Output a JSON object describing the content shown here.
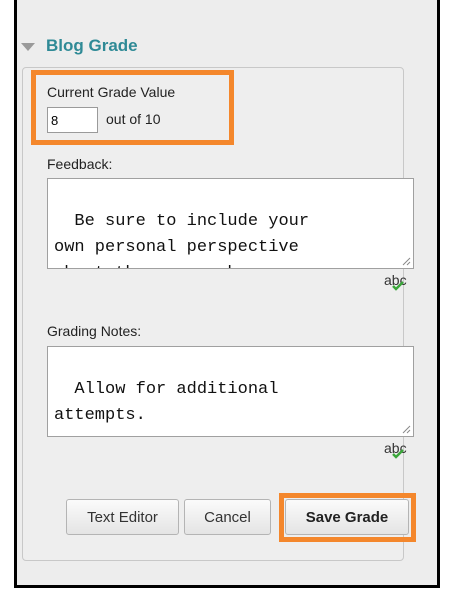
{
  "section": {
    "title": "Blog Grade",
    "icon": "collapse-triangle-icon"
  },
  "grade": {
    "label": "Current Grade Value",
    "value": "8",
    "out_of_text": "out of 10"
  },
  "feedback": {
    "label": "Feedback:",
    "text": "Be sure to include your\nown personal perspective\nabout the research."
  },
  "grading_notes": {
    "label": "Grading Notes:",
    "text": "Allow for additional\nattempts."
  },
  "spellcheck": {
    "label": "abc",
    "icon": "spellcheck-icon",
    "check_color": "#3aa63a"
  },
  "buttons": {
    "text_editor": "Text Editor",
    "cancel": "Cancel",
    "save_grade": "Save Grade"
  },
  "colors": {
    "highlight": "#f4872c",
    "header_title": "#2f8a96"
  }
}
